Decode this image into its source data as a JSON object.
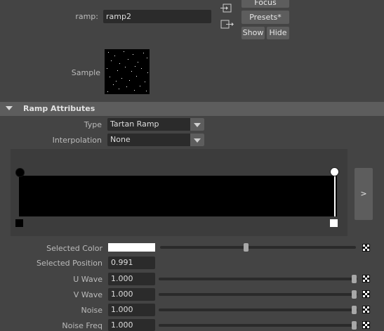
{
  "node": {
    "name_label": "ramp:",
    "name_value": "ramp2"
  },
  "buttons": {
    "focus": "Focus",
    "presets": "Presets*",
    "show": "Show",
    "hide": "Hide"
  },
  "sample": {
    "label": "Sample"
  },
  "section": {
    "title": "Ramp Attributes"
  },
  "type_field": {
    "label": "Type",
    "value": "Tartan Ramp"
  },
  "interpolation_field": {
    "label": "Interpolation",
    "value": "None"
  },
  "ramp_editor": {
    "expand_label": ">"
  },
  "attributes": {
    "selected_color": {
      "label": "Selected Color",
      "swatch_color": "#ffffff",
      "slider": 0.45
    },
    "selected_position": {
      "label": "Selected Position",
      "value": "0.991"
    },
    "u_wave": {
      "label": "U Wave",
      "value": "1.000",
      "slider": 1.0
    },
    "v_wave": {
      "label": "V Wave",
      "value": "1.000",
      "slider": 1.0
    },
    "noise": {
      "label": "Noise",
      "value": "1.000",
      "slider": 1.0
    },
    "noise_freq": {
      "label": "Noise Freq",
      "value": "1.000",
      "slider": 1.0
    }
  }
}
